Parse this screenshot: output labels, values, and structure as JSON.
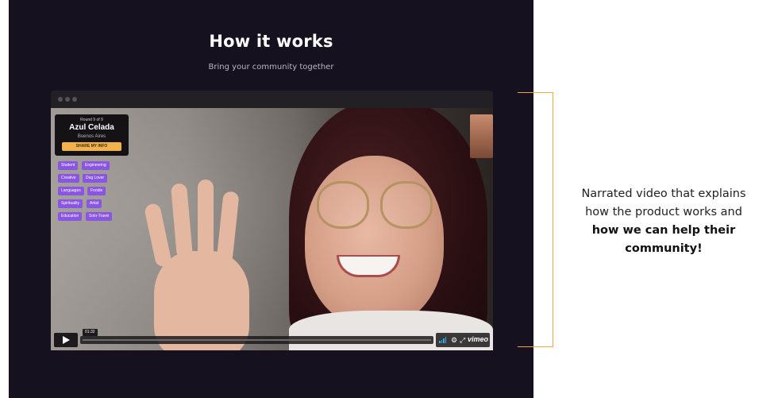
{
  "section": {
    "title": "How it works",
    "subtitle": "Bring your community together"
  },
  "video": {
    "card": {
      "round": "Round 9 of 9",
      "name": "Azul Celada",
      "city": "Buenos Aires",
      "share_button": "SHARE MY INFO"
    },
    "tags": [
      "Student",
      "Engineering",
      "Creative",
      "Dog Lover",
      "Languages",
      "Foodie",
      "Spirituality",
      "Artist",
      "Education",
      "Solo-Travel"
    ],
    "player": {
      "time": "01:32",
      "brand": "vimeo",
      "progress": 0.0
    }
  },
  "annotation": {
    "line1": "Narrated video that explains",
    "line2": "how the product works and",
    "line3_bold": "how we can help their",
    "line4_bold": "community!"
  },
  "colors": {
    "panel_bg": "#15111f",
    "accent_bracket": "#e9a93b",
    "tag_bg": "#8a55e0",
    "share_btn": "#f2b24b"
  }
}
